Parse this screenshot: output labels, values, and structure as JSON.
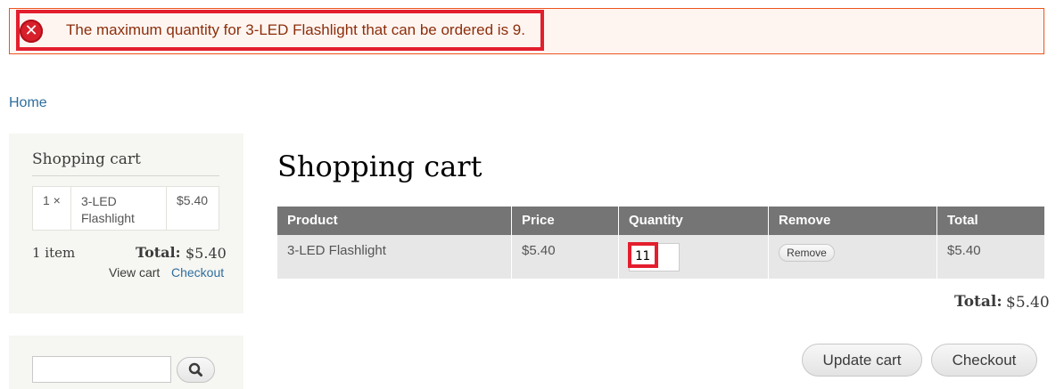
{
  "message": {
    "error_text": "The maximum quantity for 3-LED Flashlight that can be ordered is 9.",
    "icon": "error-icon"
  },
  "breadcrumb": {
    "home": "Home"
  },
  "sidebar": {
    "cart": {
      "title": "Shopping cart",
      "items": [
        {
          "qty": "1 ×",
          "name": "3-LED Flashlight",
          "price": "$5.40"
        }
      ],
      "item_count": "1 item",
      "total_label": "Total:",
      "total_value": "$5.40",
      "view_cart": "View cart",
      "checkout": "Checkout"
    },
    "search": {
      "placeholder": "",
      "button_icon": "search-icon"
    }
  },
  "main": {
    "title": "Shopping cart",
    "columns": [
      "Product",
      "Price",
      "Quantity",
      "Remove",
      "Total"
    ],
    "rows": [
      {
        "product": "3-LED Flashlight",
        "price": "$5.40",
        "quantity": "11",
        "remove_label": "Remove",
        "total": "$5.40"
      }
    ],
    "total_label": "Total:",
    "total_value": "$5.40",
    "update_label": "Update cart",
    "checkout_label": "Checkout"
  },
  "colors": {
    "error_border": "#ed541d",
    "error_background": "#fef5f1",
    "highlight": "#e31e2d",
    "link": "#2f6e9e",
    "table_header": "#757575"
  }
}
